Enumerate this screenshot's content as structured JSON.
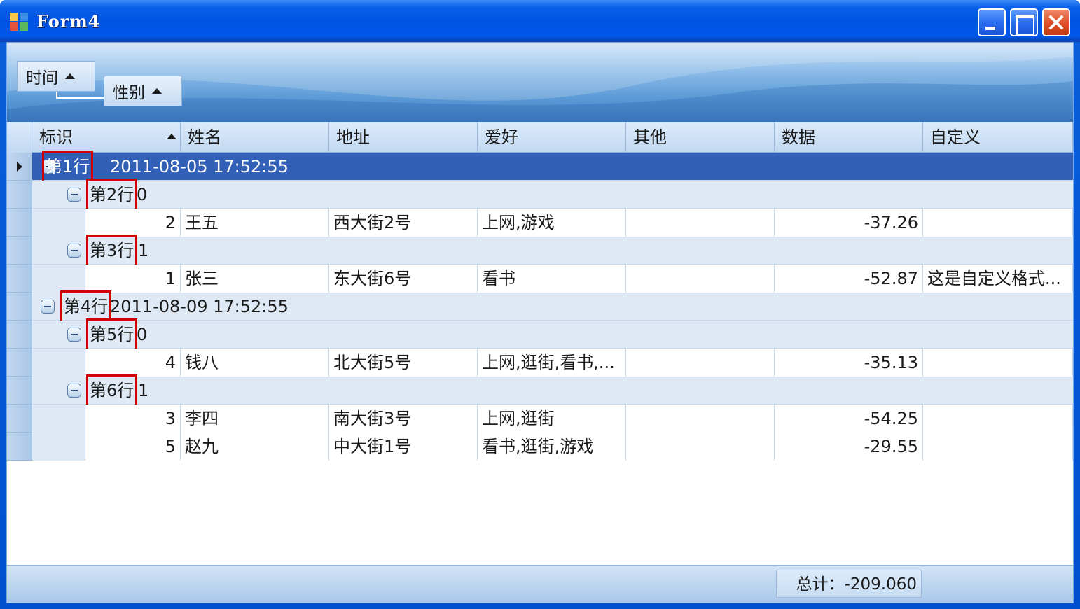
{
  "window": {
    "title": "Form4"
  },
  "group_panel": {
    "chips": [
      {
        "label": "时间"
      },
      {
        "label": "性别"
      }
    ]
  },
  "columns": [
    "标识",
    "姓名",
    "地址",
    "爱好",
    "其他",
    "数据",
    "自定义"
  ],
  "groups": [
    {
      "tag": "第1行",
      "value": "2011-08-05 17:52:55",
      "subgroups": [
        {
          "tag": "第2行",
          "value": "0",
          "rows": [
            {
              "id": "2",
              "name": "王五",
              "address": "西大街2号",
              "hobby": "上网,游戏",
              "other": "",
              "data": "-37.26",
              "custom": ""
            }
          ]
        },
        {
          "tag": "第3行",
          "value": "1",
          "rows": [
            {
              "id": "1",
              "name": "张三",
              "address": "东大街6号",
              "hobby": "看书",
              "other": "",
              "data": "-52.87",
              "custom": "这是自定义格式..."
            }
          ]
        }
      ]
    },
    {
      "tag": "第4行",
      "value": "2011-08-09 17:52:55",
      "subgroups": [
        {
          "tag": "第5行",
          "value": "0",
          "rows": [
            {
              "id": "4",
              "name": "钱八",
              "address": "北大街5号",
              "hobby": "上网,逛街,看书,...",
              "other": "",
              "data": "-35.13",
              "custom": ""
            }
          ]
        },
        {
          "tag": "第6行",
          "value": "1",
          "rows": [
            {
              "id": "3",
              "name": "李四",
              "address": "南大街3号",
              "hobby": "上网,逛街",
              "other": "",
              "data": "-54.25",
              "custom": ""
            },
            {
              "id": "5",
              "name": "赵九",
              "address": "中大街1号",
              "hobby": "看书,逛街,游戏",
              "other": "",
              "data": "-29.55",
              "custom": ""
            }
          ]
        }
      ]
    }
  ],
  "footer": {
    "total": "总计：-209.060"
  },
  "colors": {
    "titlebar": "#0054e3",
    "selected_row": "#3260b6",
    "group_row": "#dfe9f6",
    "highlight_box": "#d40000"
  }
}
